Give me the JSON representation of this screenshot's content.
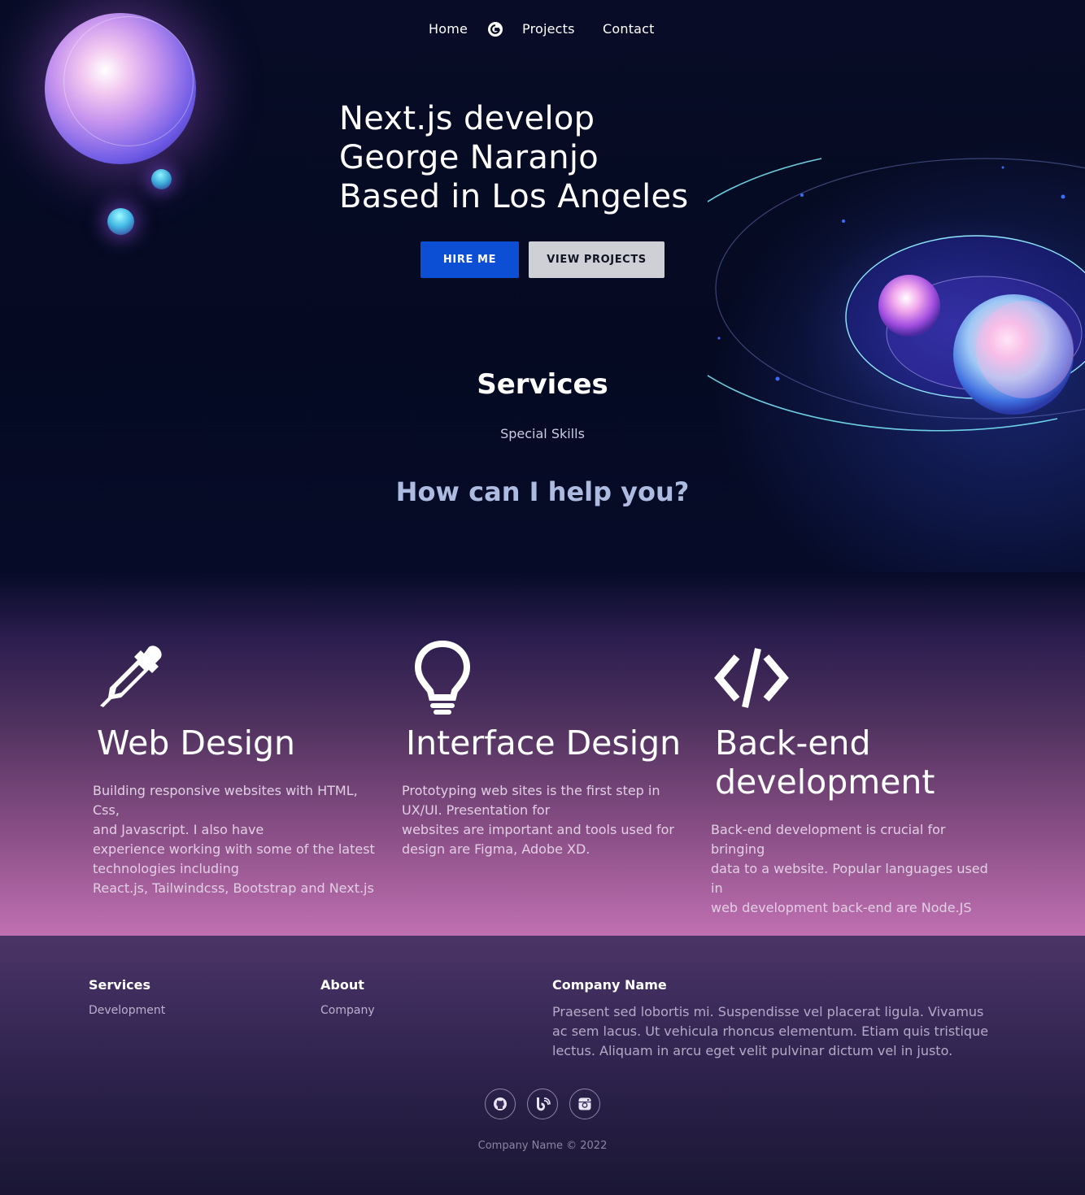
{
  "nav": {
    "home": "Home",
    "projects": "Projects",
    "contact": "Contact",
    "logo_icon": "google-g-icon"
  },
  "hero": {
    "line1": "Next.js develop",
    "line2": "George Naranjo",
    "line3": "Based in Los Angeles",
    "hire_label": "HIRE ME",
    "view_label": "VIEW PROJECTS"
  },
  "services": {
    "title": "Services",
    "subtitle": "Special Skills",
    "question": "How can I help you?",
    "cards": [
      {
        "icon": "eyedropper-icon",
        "title": "Web Design",
        "lines": [
          "Building responsive websites with HTML, Css,",
          "and Javascript. I also have",
          "experience working with some of the latest",
          "technologies including",
          "React.js, Tailwindcss, Bootstrap and Next.js"
        ]
      },
      {
        "icon": "lightbulb-icon",
        "title": "Interface Design",
        "lines": [
          "Prototyping web sites is the first step in",
          "UX/UI. Presentation for",
          "websites are important and tools used for",
          "design are Figma, Adobe XD."
        ]
      },
      {
        "icon": "code-icon",
        "title_line1": "Back-end",
        "title_line2": "development",
        "lines": [
          "Back-end development is crucial for bringing",
          "data to a website. Popular languages used in",
          "web development back-end are Node.JS"
        ]
      }
    ]
  },
  "footer": {
    "col1_head": "Services",
    "col1_link": "Development",
    "col2_head": "About",
    "col2_link": "Company",
    "col3_head": "Company Name",
    "col3_text": "Praesent sed lobortis mi. Suspendisse vel placerat ligula. Vivamus ac sem lacus. Ut vehicula rhoncus elementum. Etiam quis tristique lectus. Aliquam in arcu eget velit pulvinar dictum vel in justo.",
    "social_icons": [
      "github-icon",
      "blog-icon",
      "instagram-icon"
    ],
    "copyright": "Company Name © 2022"
  },
  "colors": {
    "hire_button": "#0c4fd4",
    "view_button": "#cfd0d6",
    "hero_bg": "#060a24",
    "band_bottom": "#c070b1"
  }
}
